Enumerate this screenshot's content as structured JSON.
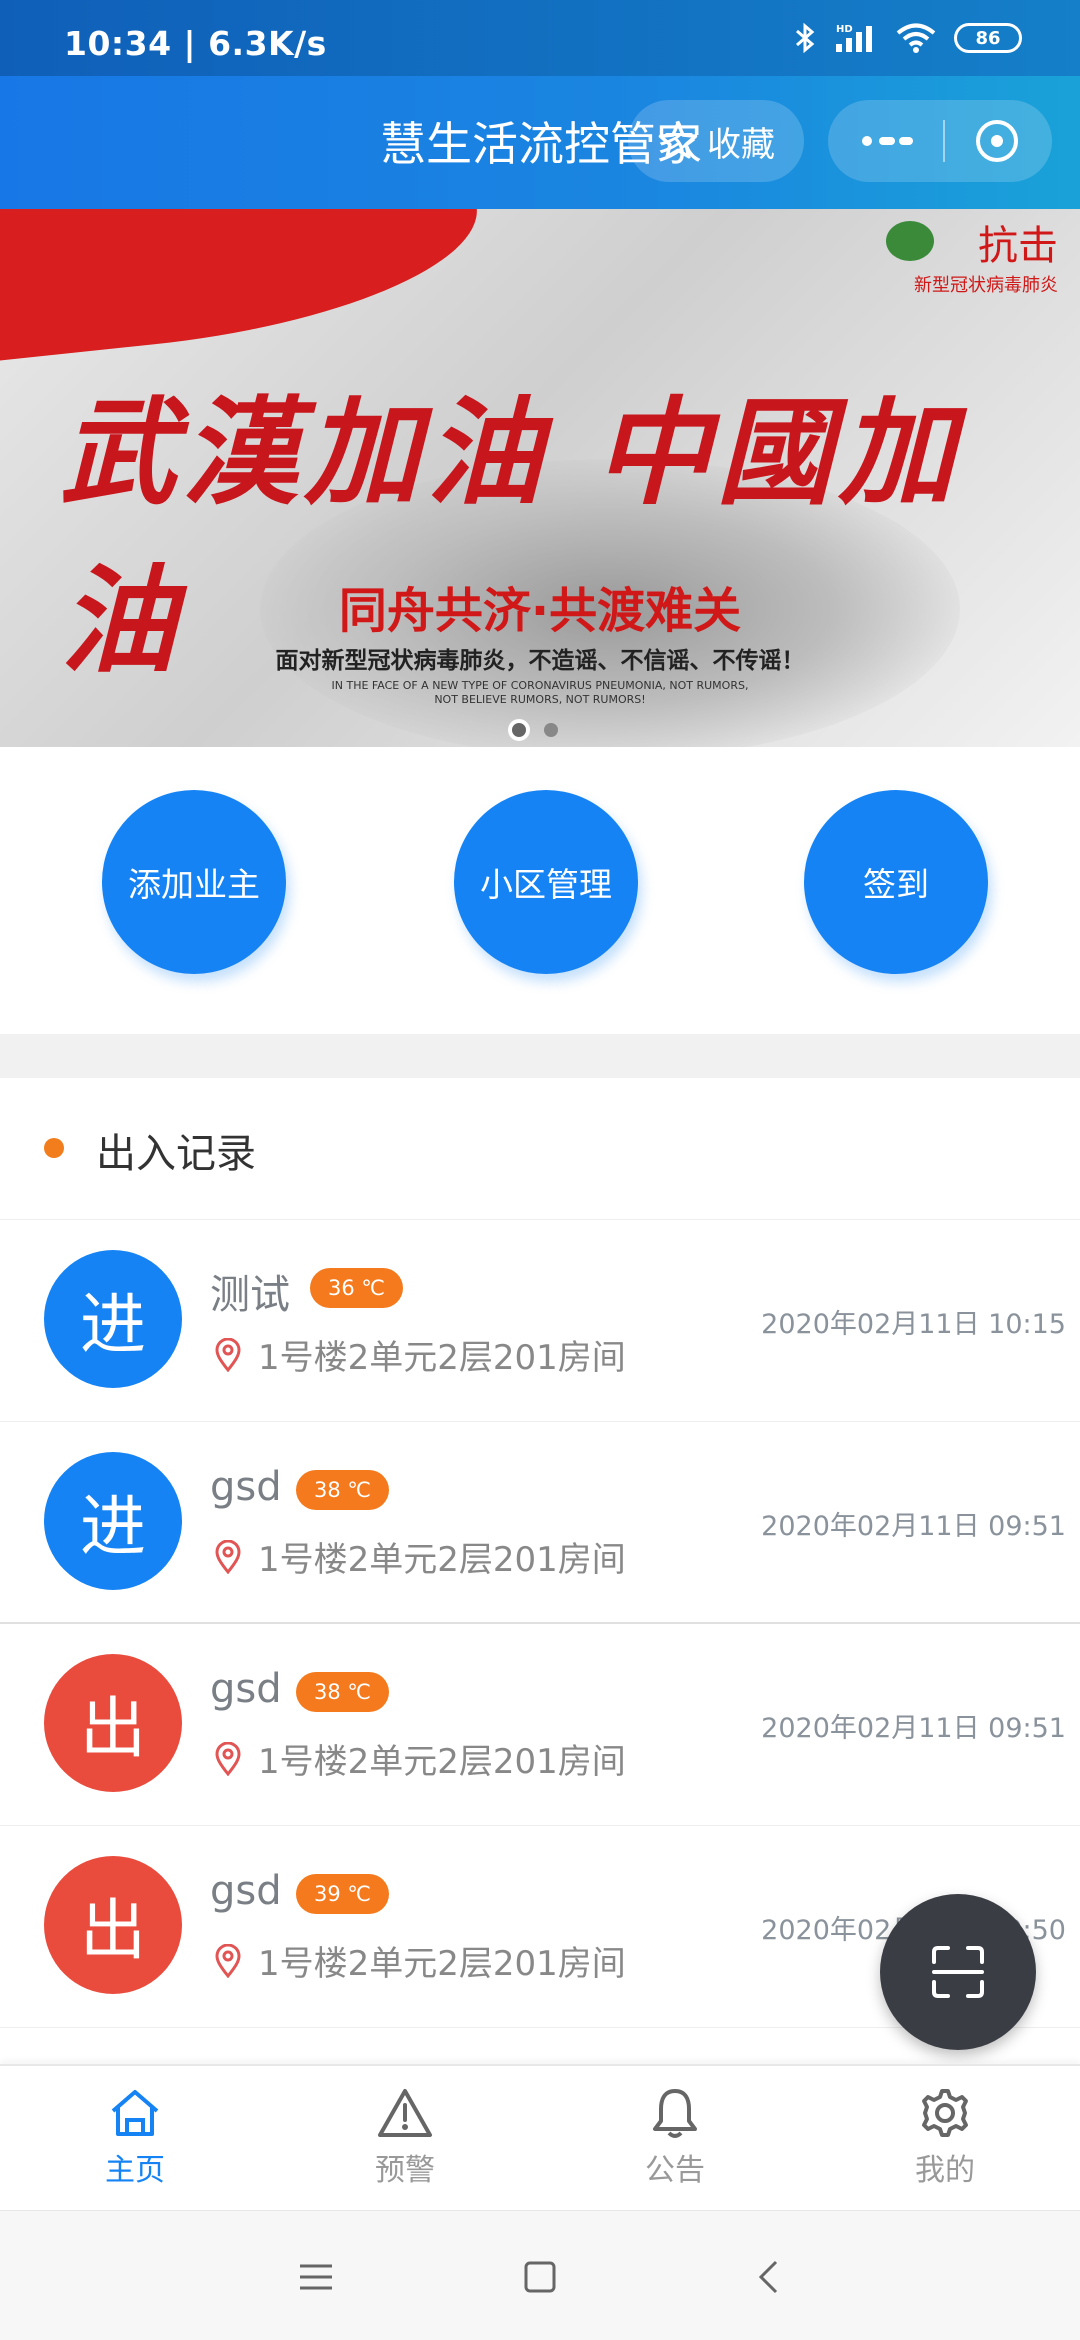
{
  "status_bar": {
    "time": "10:34 | 6.3K/s",
    "battery": "86",
    "network": "HD"
  },
  "header": {
    "title": "慧生活流控管家",
    "favorite_label": "收藏"
  },
  "banner": {
    "badge_title": "抗击",
    "badge_sub": "新型冠状病毒肺炎",
    "headline": "武漢加油 中國加油",
    "subtitle": "同舟共济·共渡难关",
    "description": "面对新型冠状病毒肺炎，不造谣、不信谣、不传谣！",
    "english_1": "IN THE FACE OF A NEW TYPE OF CORONAVIRUS PNEUMONIA, NOT RUMORS,",
    "english_2": "NOT BELIEVE RUMORS, NOT RUMORS!",
    "slide_count": 2,
    "active_slide": 1
  },
  "actions": [
    {
      "label": "添加业主"
    },
    {
      "label": "小区管理"
    },
    {
      "label": "签到"
    }
  ],
  "records_section": {
    "title": "出入记录"
  },
  "records": [
    {
      "direction": "进",
      "type": "in",
      "name": "测试",
      "temp": "36 ℃",
      "address": "1号楼2单元2层201房间",
      "time": "2020年02月11日 10:15"
    },
    {
      "direction": "进",
      "type": "in",
      "name": "gsd",
      "temp": "38 ℃",
      "address": "1号楼2单元2层201房间",
      "time": "2020年02月11日 09:51"
    },
    {
      "direction": "出",
      "type": "out",
      "name": "gsd",
      "temp": "38 ℃",
      "address": "1号楼2单元2层201房间",
      "time": "2020年02月11日 09:51"
    },
    {
      "direction": "出",
      "type": "out",
      "name": "gsd",
      "temp": "39 ℃",
      "address": "1号楼2单元2层201房间",
      "time": "2020年02月11日 09:50"
    }
  ],
  "tabs": [
    {
      "label": "主页",
      "icon": "home-icon",
      "active": true
    },
    {
      "label": "预警",
      "icon": "warning-icon",
      "active": false
    },
    {
      "label": "公告",
      "icon": "bell-icon",
      "active": false
    },
    {
      "label": "我的",
      "icon": "gear-icon",
      "active": false
    }
  ],
  "colors": {
    "primary": "#1583f4",
    "out": "#e94c3d",
    "temp_badge": "#f47a1d",
    "fab": "#3b3d44"
  }
}
